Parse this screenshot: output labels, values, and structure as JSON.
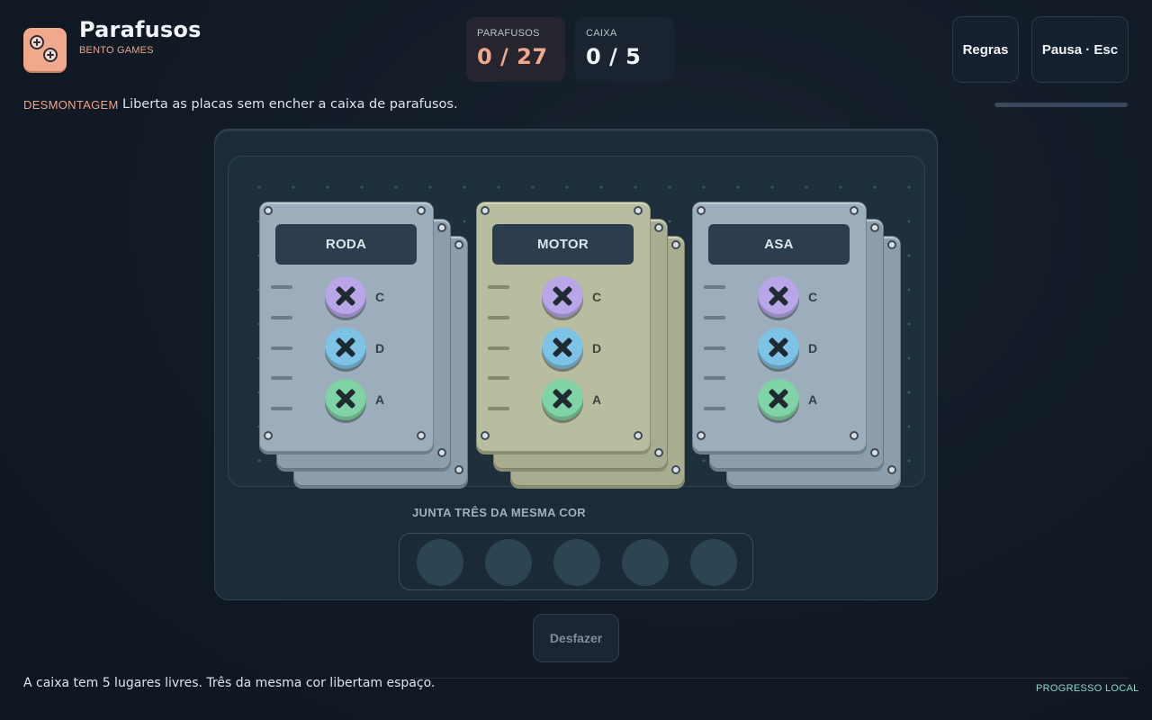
{
  "header": {
    "title": "Parafusos",
    "subtitle": "BENTO GAMES",
    "logo_icon": "screws-logo-icon"
  },
  "stats": {
    "screws": {
      "label": "PARAFUSOS",
      "value": "0 / 27"
    },
    "box": {
      "label": "CAIXA",
      "value": "0 / 5"
    }
  },
  "buttons": {
    "rules": "Regras",
    "pause": "Pausa · Esc",
    "undo": "Desfazer"
  },
  "mode": {
    "tag": "DESMONTAGEM",
    "description": "Liberta as placas sem encher a caixa de parafusos."
  },
  "plates": [
    {
      "label": "RODA",
      "color": "#9caebb",
      "screws": [
        {
          "letter": "C",
          "color": "#b9a6e8"
        },
        {
          "letter": "D",
          "color": "#7cc3e6"
        },
        {
          "letter": "A",
          "color": "#7fd3a4"
        }
      ]
    },
    {
      "label": "MOTOR",
      "color": "#b8bd9f",
      "screws": [
        {
          "letter": "C",
          "color": "#b9a6e8"
        },
        {
          "letter": "D",
          "color": "#7cc3e6"
        },
        {
          "letter": "A",
          "color": "#7fd3a4"
        }
      ]
    },
    {
      "label": "ASA",
      "color": "#9caebb",
      "screws": [
        {
          "letter": "C",
          "color": "#b9a6e8"
        },
        {
          "letter": "D",
          "color": "#7cc3e6"
        },
        {
          "letter": "A",
          "color": "#7fd3a4"
        }
      ]
    }
  ],
  "tray": {
    "title": "JUNTA TRÊS DA MESMA COR",
    "slots": 5
  },
  "footer": {
    "hint": "A caixa tem 5 lugares livres. Três da mesma cor libertam espaço.",
    "storage": "PROGRESSO LOCAL"
  },
  "colors": {
    "accent": "#f2a88b",
    "background": "#111a25",
    "teal": "#8fd8cf"
  }
}
